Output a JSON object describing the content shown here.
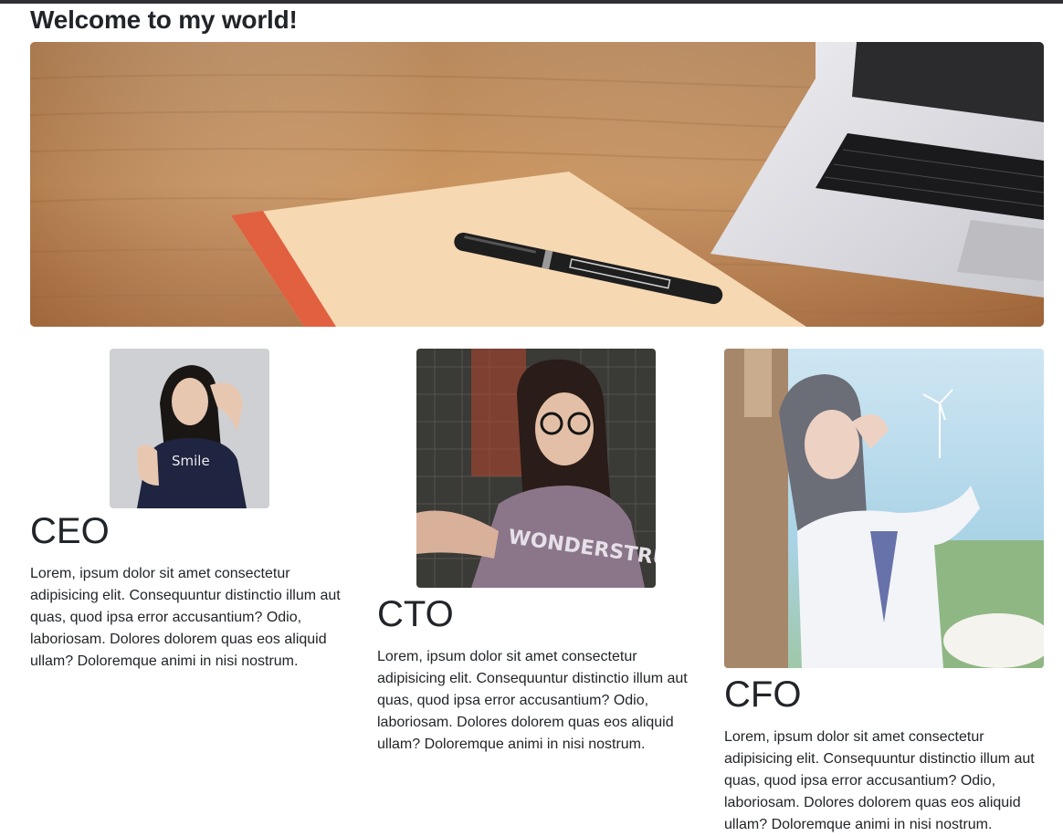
{
  "page": {
    "title": "Welcome to my world!"
  },
  "hero": {
    "alt": "Desk with notebook, pen and laptop"
  },
  "team": [
    {
      "role": "CEO",
      "text": "Lorem, ipsum dolor sit amet consectetur adipisicing elit. Consequuntur distinctio illum aut quas, quod ipsa error accusantium? Odio, laboriosam. Dolores dolorem quas eos aliquid ullam? Doloremque animi in nisi nostrum."
    },
    {
      "role": "CTO",
      "text": "Lorem, ipsum dolor sit amet consectetur adipisicing elit. Consequuntur distinctio illum aut quas, quod ipsa error accusantium? Odio, laboriosam. Dolores dolorem quas eos aliquid ullam? Doloremque animi in nisi nostrum."
    },
    {
      "role": "CFO",
      "text": "Lorem, ipsum dolor sit amet consectetur adipisicing elit. Consequuntur distinctio illum aut quas, quod ipsa error accusantium? Odio, laboriosam. Dolores dolorem quas eos aliquid ullam? Doloremque animi in nisi nostrum."
    }
  ],
  "colors": {
    "topbar": "#2f3033",
    "text": "#212529"
  }
}
